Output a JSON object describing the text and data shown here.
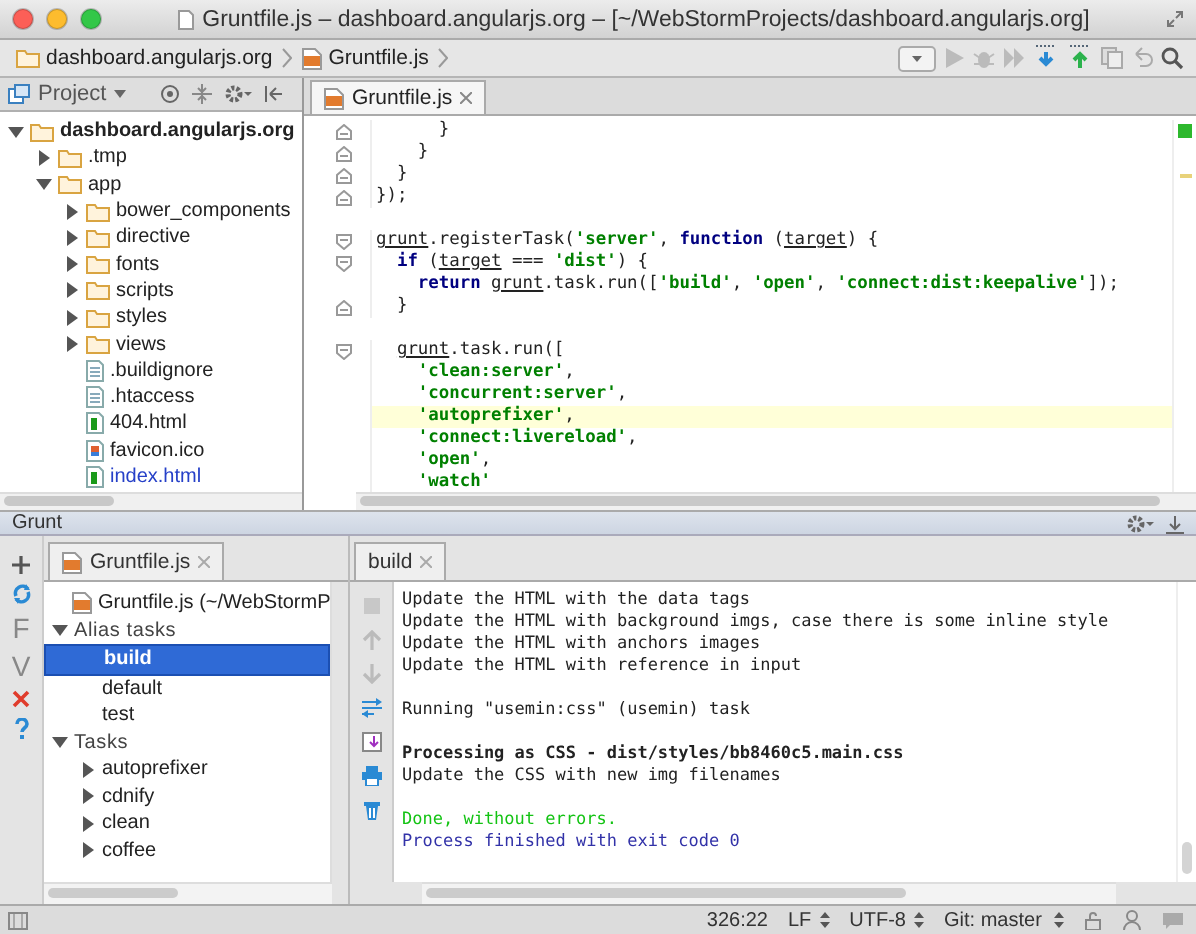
{
  "window": {
    "title": "Gruntfile.js – dashboard.angularjs.org – [~/WebStormProjects/dashboard.angularjs.org]"
  },
  "breadcrumbs": [
    "dashboard.angularjs.org",
    "Gruntfile.js"
  ],
  "project_panel": {
    "title": "Project",
    "tree": [
      {
        "label": "dashboard.angularjs.org",
        "kind": "folder",
        "expanded": true,
        "children": [
          {
            "label": ".tmp",
            "kind": "folder",
            "expanded": false
          },
          {
            "label": "app",
            "kind": "folder",
            "expanded": true,
            "children": [
              {
                "label": "bower_components",
                "kind": "folder",
                "expanded": false
              },
              {
                "label": "directive",
                "kind": "folder",
                "expanded": false
              },
              {
                "label": "fonts",
                "kind": "folder",
                "expanded": false
              },
              {
                "label": "scripts",
                "kind": "folder",
                "expanded": false
              },
              {
                "label": "styles",
                "kind": "folder",
                "expanded": false
              },
              {
                "label": "views",
                "kind": "folder",
                "expanded": false
              },
              {
                "label": ".buildignore",
                "kind": "text",
                "modified": false
              },
              {
                "label": ".htaccess",
                "kind": "text",
                "modified": false
              },
              {
                "label": "404.html",
                "kind": "html",
                "modified": false
              },
              {
                "label": "favicon.ico",
                "kind": "image",
                "modified": false
              },
              {
                "label": "index.html",
                "kind": "html",
                "modified": true
              }
            ]
          }
        ]
      }
    ]
  },
  "editor": {
    "tabs": [
      {
        "label": "Gruntfile.js",
        "selected": true
      }
    ],
    "blocks": [
      {
        "lines": [
          {
            "kind": "fold_end",
            "current": false,
            "tokens": [
              {
                "kind": "plain",
                "text": "      }"
              }
            ]
          },
          {
            "kind": "fold_end",
            "current": false,
            "tokens": [
              {
                "kind": "plain",
                "text": "    }"
              }
            ]
          },
          {
            "kind": "fold_end",
            "current": false,
            "tokens": [
              {
                "kind": "plain",
                "text": "  }"
              }
            ]
          },
          {
            "kind": "fold_end",
            "current": false,
            "tokens": [
              {
                "kind": "plain",
                "text": "});"
              }
            ]
          }
        ]
      },
      {
        "lines": [
          {
            "kind": "fold_start",
            "current": false,
            "tokens": [
              {
                "kind": "ref",
                "text": "grunt"
              },
              {
                "kind": "plain",
                "text": ".registerTask("
              },
              {
                "kind": "string",
                "text": "'server'"
              },
              {
                "kind": "plain",
                "text": ", "
              },
              {
                "kind": "keyword",
                "text": "function"
              },
              {
                "kind": "plain",
                "text": " ("
              },
              {
                "kind": "ref",
                "text": "target"
              },
              {
                "kind": "plain",
                "text": ") {"
              }
            ]
          },
          {
            "kind": "fold_start",
            "current": false,
            "tokens": [
              {
                "kind": "keyword",
                "text": "  if"
              },
              {
                "kind": "plain",
                "text": " ("
              },
              {
                "kind": "ref",
                "text": "target"
              },
              {
                "kind": "plain",
                "text": " === "
              },
              {
                "kind": "string",
                "text": "'dist'"
              },
              {
                "kind": "plain",
                "text": ") {"
              }
            ]
          },
          {
            "kind": "plain",
            "current": false,
            "tokens": [
              {
                "kind": "keyword",
                "text": "    return"
              },
              {
                "kind": "ref",
                "text": " grunt"
              },
              {
                "kind": "plain",
                "text": ".task.run(["
              },
              {
                "kind": "string",
                "text": "'build'"
              },
              {
                "kind": "plain",
                "text": ", "
              },
              {
                "kind": "string",
                "text": "'open'"
              },
              {
                "kind": "plain",
                "text": ", "
              },
              {
                "kind": "string",
                "text": "'connect:dist:keepalive'"
              },
              {
                "kind": "plain",
                "text": "]);"
              }
            ]
          },
          {
            "kind": "fold_end",
            "current": false,
            "tokens": [
              {
                "kind": "plain",
                "text": "  }"
              }
            ]
          }
        ]
      },
      {
        "lines": [
          {
            "kind": "fold_start",
            "current": false,
            "tokens": [
              {
                "kind": "ref",
                "text": "  grunt"
              },
              {
                "kind": "plain",
                "text": ".task.run(["
              }
            ]
          },
          {
            "kind": "plain",
            "current": false,
            "tokens": [
              {
                "kind": "string",
                "text": "    'clean:server'"
              },
              {
                "kind": "plain",
                "text": ","
              }
            ]
          },
          {
            "kind": "plain",
            "current": false,
            "tokens": [
              {
                "kind": "string",
                "text": "    'concurrent:server'"
              },
              {
                "kind": "plain",
                "text": ","
              }
            ]
          },
          {
            "kind": "plain",
            "current": true,
            "tokens": [
              {
                "kind": "string",
                "text": "    'autoprefixer'"
              },
              {
                "kind": "plain",
                "text": ","
              }
            ]
          },
          {
            "kind": "plain",
            "current": false,
            "tokens": [
              {
                "kind": "string",
                "text": "    'connect:livereload'"
              },
              {
                "kind": "plain",
                "text": ","
              }
            ]
          },
          {
            "kind": "plain",
            "current": false,
            "tokens": [
              {
                "kind": "string",
                "text": "    'open'"
              },
              {
                "kind": "plain",
                "text": ","
              }
            ]
          },
          {
            "kind": "plain",
            "current": false,
            "tokens": [
              {
                "kind": "string",
                "text": "    'watch'"
              }
            ]
          }
        ]
      }
    ]
  },
  "grunt_panel": {
    "title": "Grunt",
    "side_tools": [
      {
        "kind": "add"
      },
      {
        "kind": "refresh"
      },
      {
        "kind": "letter",
        "text": "F"
      },
      {
        "kind": "letter",
        "text": "V"
      },
      {
        "kind": "remove"
      },
      {
        "kind": "help"
      }
    ],
    "tabs": [
      {
        "label": "Gruntfile.js",
        "selected": true
      }
    ],
    "tree": [
      {
        "label": "Gruntfile.js (~/WebStormP",
        "kind": "gruntfile"
      },
      {
        "label": "Alias tasks",
        "kind": "group",
        "expanded": true,
        "children": [
          {
            "label": "build",
            "kind": "task",
            "selected": true
          },
          {
            "label": "default",
            "kind": "task",
            "selected": false
          },
          {
            "label": "test",
            "kind": "task",
            "selected": false
          }
        ]
      },
      {
        "label": "Tasks",
        "kind": "group",
        "expanded": true,
        "children": [
          {
            "label": "autoprefixer",
            "kind": "task",
            "selected": false,
            "expanded": false
          },
          {
            "label": "cdnify",
            "kind": "task",
            "selected": false,
            "expanded": false
          },
          {
            "label": "clean",
            "kind": "task",
            "selected": false,
            "expanded": false
          },
          {
            "label": "coffee",
            "kind": "task",
            "selected": false,
            "expanded": false
          }
        ]
      }
    ]
  },
  "console": {
    "tabs": [
      {
        "label": "build",
        "selected": true
      }
    ],
    "blocks": [
      {
        "lines": [
          {
            "text": "Update the HTML with the data tags",
            "kind": "normal"
          },
          {
            "text": "Update the HTML with background imgs, case there is some inline style",
            "kind": "normal"
          },
          {
            "text": "Update the HTML with anchors images",
            "kind": "normal"
          },
          {
            "text": "Update the HTML with reference in input",
            "kind": "normal"
          }
        ]
      },
      {
        "lines": [
          {
            "text": "Running \"usemin:css\" (usemin) task",
            "kind": "normal"
          }
        ]
      },
      {
        "lines": [
          {
            "text": "Processing as CSS - dist/styles/bb8460c5.main.css",
            "kind": "bold"
          },
          {
            "text": "Update the CSS with new img filenames",
            "kind": "normal"
          }
        ]
      },
      {
        "lines": [
          {
            "text": "Done, without errors.",
            "kind": "success"
          },
          {
            "text": "Process finished with exit code 0",
            "kind": "info"
          }
        ]
      }
    ]
  },
  "status_bar": {
    "position": "326:22",
    "line_separator": "LF",
    "encoding": "UTF-8",
    "vcs_branch": "Git: master"
  }
}
